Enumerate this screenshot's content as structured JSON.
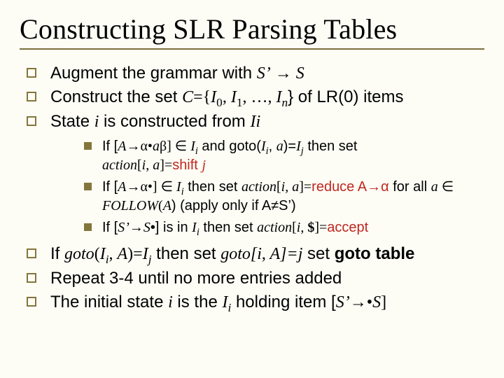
{
  "title": "Constructing SLR Parsing Tables",
  "b1_a": "Augment the grammar with ",
  "b1_b": "S’",
  "b1_c": " → ",
  "b1_d": "S",
  "b2_a": "Construct the set ",
  "b2_b": "C",
  "b2_c": "={",
  "b2_d": "I",
  "b2_e": "0",
  "b2_f": ", ",
  "b2_g": "I",
  "b2_h": "1",
  "b2_i": ", …, ",
  "b2_j": "I",
  "b2_k": "n",
  "b2_l": "} of LR(0) items",
  "b3_a": "State ",
  "b3_b": "i",
  "b3_c": " is constructed from ",
  "b3_d": "Ii",
  "s1_a": "If [",
  "s1_b": "A",
  "s1_c": "→α•",
  "s1_d": "a",
  "s1_e": "β]  ∈ ",
  "s1_f": "I",
  "s1_g": "i",
  "s1_h": " and goto(",
  "s1_i": "I",
  "s1_j": "i",
  "s1_k": ", ",
  "s1_l": "a",
  "s1_m": ")=",
  "s1_n": "I",
  "s1_o": "j",
  "s1_p": " then set",
  "s1_q": "action",
  "s1_r": "[",
  "s1_s": "i",
  "s1_t": ", ",
  "s1_u": "a",
  "s1_v": "]=",
  "s1_w": "shift ",
  "s1_x": "j",
  "s2_a": "If [",
  "s2_b": "A",
  "s2_c": "→α•]  ∈ ",
  "s2_d": "I",
  "s2_e": "i",
  "s2_f": " then set ",
  "s2_g": "action",
  "s2_h": "[",
  "s2_i": "i",
  "s2_j": ", ",
  "s2_k": "a",
  "s2_l": "]=",
  "s2_m": "reduce A→α",
  "s2_n": " for all ",
  "s2_o": "a",
  "s2_p": " ∈",
  "s2_q": "FOLLOW",
  "s2_r": "(",
  "s2_s": "A",
  "s2_t": ") (apply only if A≠S’)",
  "s3_a": "If [",
  "s3_b": "S’",
  "s3_c": "→",
  "s3_d": "S",
  "s3_e": "•] is in ",
  "s3_f": "I",
  "s3_g": "i",
  "s3_h": " then set ",
  "s3_i": "action",
  "s3_j": "[",
  "s3_k": "i",
  "s3_l": ", ",
  "s3_m": "$",
  "s3_n": "]=",
  "s3_o": "accept",
  "b4_a": "If ",
  "b4_b": "goto",
  "b4_c": "(",
  "b4_d": "I",
  "b4_e": "i",
  "b4_f": ", ",
  "b4_g": "A",
  "b4_h": ")=",
  "b4_i": "I",
  "b4_j": "j",
  "b4_k": " then set ",
  "b4_l": "goto[i, A]=j",
  "b4_m": " set ",
  "b4_n": "goto table",
  "b5": "Repeat 3-4 until no more entries added",
  "b6_a": "The initial state ",
  "b6_b": "i",
  "b6_c": " is the ",
  "b6_d": "I",
  "b6_e": "i",
  "b6_f": " holding item [",
  "b6_g": "S’",
  "b6_h": "→•",
  "b6_i": "S",
  "b6_j": "]"
}
